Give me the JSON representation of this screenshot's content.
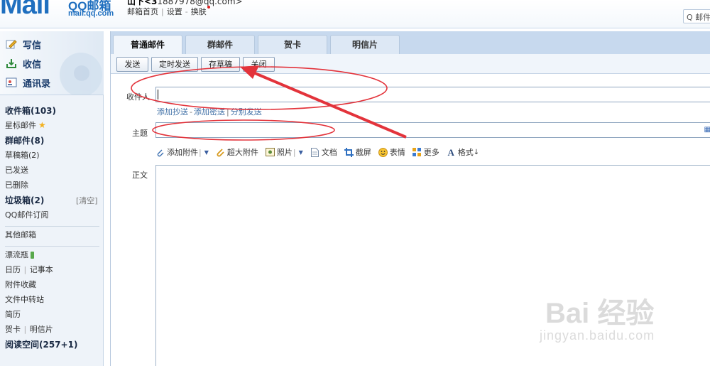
{
  "header": {
    "logo_text": "Mail",
    "logo_qq": "QQ邮箱",
    "logo_url": "mail.qq.com",
    "account_prefix": "山下<3",
    "account_email": "1887978@qq.com",
    "account_suffix": ">",
    "links": [
      "邮箱首页",
      "设置",
      "换肤"
    ],
    "search_label": "Q 邮件"
  },
  "sidebar": {
    "actions": [
      {
        "label": "写信",
        "icon": "pencil-icon"
      },
      {
        "label": "收信",
        "icon": "inbox-tray-icon"
      },
      {
        "label": "通讯录",
        "icon": "contacts-icon"
      }
    ],
    "folders": {
      "inbox": "收件箱(103)",
      "starred": "星标邮件",
      "group": "群邮件(8)",
      "drafts": "草稿箱(2)",
      "sent": "已发送",
      "deleted": "已删除",
      "trash": "垃圾箱(2)",
      "trash_clear": "[清空]",
      "subscription": "QQ邮件订阅",
      "other": "其他邮箱",
      "bottle": "漂流瓶",
      "calendar": "日历",
      "notebook": "记事本",
      "attachments": "附件收藏",
      "transfer": "文件中转站",
      "resume": "简历",
      "cards": "贺卡",
      "postcards": "明信片",
      "reading": "阅读空间(257+1)"
    }
  },
  "main": {
    "tabs": [
      "普通邮件",
      "群邮件",
      "贺卡",
      "明信片"
    ],
    "toolbar": {
      "send": "发送",
      "scheduled": "定时发送",
      "save_draft": "存草稿",
      "close": "关闭"
    },
    "recipient_label": "收件人",
    "recipient_links": [
      "添加抄送",
      "添加密送",
      "分别发送"
    ],
    "subject_label": "主题",
    "editor_tools": [
      "添加附件",
      "超大附件",
      "照片",
      "文档",
      "截屏",
      "表情",
      "更多",
      "格式"
    ],
    "body_label": "正文"
  },
  "watermark": {
    "text": "Bai 经验",
    "sub": "jingyan.baidu.com"
  }
}
